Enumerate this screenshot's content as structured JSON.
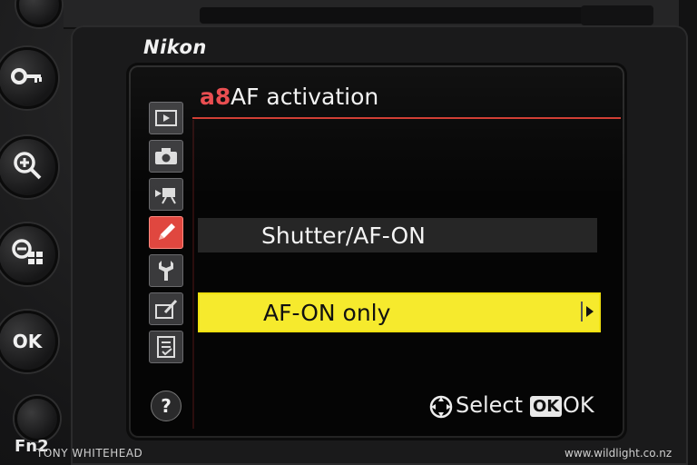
{
  "camera": {
    "brand": "Nikon",
    "buttons": {
      "ok": "OK",
      "fn2": "Fn2"
    }
  },
  "menu": {
    "code": "a8",
    "title": "AF activation",
    "options": [
      {
        "label": "Shutter/AF-ON",
        "selected": false
      },
      {
        "label": "AF-ON only",
        "selected": true
      }
    ],
    "footer": {
      "select_label": "Select",
      "ok_badge": "OK",
      "ok_label": "OK"
    },
    "help_label": "?",
    "side_icons": [
      {
        "name": "playback-menu-icon",
        "active": false
      },
      {
        "name": "photo-shooting-menu-icon",
        "active": false
      },
      {
        "name": "movie-shooting-menu-icon",
        "active": false
      },
      {
        "name": "custom-settings-pencil-icon",
        "active": true
      },
      {
        "name": "setup-wrench-icon",
        "active": false
      },
      {
        "name": "retouch-menu-icon",
        "active": false
      },
      {
        "name": "my-menu-icon",
        "active": false
      }
    ]
  },
  "watermark": {
    "author": "TONY WHITEHEAD",
    "site": "www.wildlight.co.nz"
  },
  "colors": {
    "accent_red": "#e0473f",
    "selection_yellow": "#f6ea2d",
    "screen_bg": "#050505"
  }
}
